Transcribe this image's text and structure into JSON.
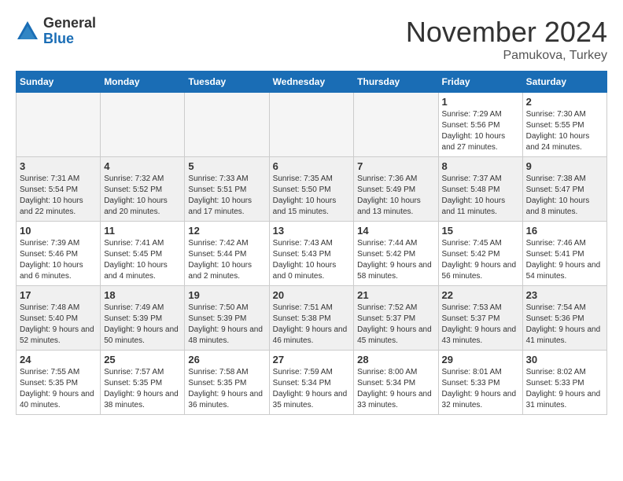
{
  "logo": {
    "general": "General",
    "blue": "Blue"
  },
  "header": {
    "month": "November 2024",
    "location": "Pamukova, Turkey"
  },
  "days_of_week": [
    "Sunday",
    "Monday",
    "Tuesday",
    "Wednesday",
    "Thursday",
    "Friday",
    "Saturday"
  ],
  "weeks": [
    [
      {
        "day": "",
        "info": ""
      },
      {
        "day": "",
        "info": ""
      },
      {
        "day": "",
        "info": ""
      },
      {
        "day": "",
        "info": ""
      },
      {
        "day": "",
        "info": ""
      },
      {
        "day": "1",
        "info": "Sunrise: 7:29 AM\nSunset: 5:56 PM\nDaylight: 10 hours and 27 minutes."
      },
      {
        "day": "2",
        "info": "Sunrise: 7:30 AM\nSunset: 5:55 PM\nDaylight: 10 hours and 24 minutes."
      }
    ],
    [
      {
        "day": "3",
        "info": "Sunrise: 7:31 AM\nSunset: 5:54 PM\nDaylight: 10 hours and 22 minutes."
      },
      {
        "day": "4",
        "info": "Sunrise: 7:32 AM\nSunset: 5:52 PM\nDaylight: 10 hours and 20 minutes."
      },
      {
        "day": "5",
        "info": "Sunrise: 7:33 AM\nSunset: 5:51 PM\nDaylight: 10 hours and 17 minutes."
      },
      {
        "day": "6",
        "info": "Sunrise: 7:35 AM\nSunset: 5:50 PM\nDaylight: 10 hours and 15 minutes."
      },
      {
        "day": "7",
        "info": "Sunrise: 7:36 AM\nSunset: 5:49 PM\nDaylight: 10 hours and 13 minutes."
      },
      {
        "day": "8",
        "info": "Sunrise: 7:37 AM\nSunset: 5:48 PM\nDaylight: 10 hours and 11 minutes."
      },
      {
        "day": "9",
        "info": "Sunrise: 7:38 AM\nSunset: 5:47 PM\nDaylight: 10 hours and 8 minutes."
      }
    ],
    [
      {
        "day": "10",
        "info": "Sunrise: 7:39 AM\nSunset: 5:46 PM\nDaylight: 10 hours and 6 minutes."
      },
      {
        "day": "11",
        "info": "Sunrise: 7:41 AM\nSunset: 5:45 PM\nDaylight: 10 hours and 4 minutes."
      },
      {
        "day": "12",
        "info": "Sunrise: 7:42 AM\nSunset: 5:44 PM\nDaylight: 10 hours and 2 minutes."
      },
      {
        "day": "13",
        "info": "Sunrise: 7:43 AM\nSunset: 5:43 PM\nDaylight: 10 hours and 0 minutes."
      },
      {
        "day": "14",
        "info": "Sunrise: 7:44 AM\nSunset: 5:42 PM\nDaylight: 9 hours and 58 minutes."
      },
      {
        "day": "15",
        "info": "Sunrise: 7:45 AM\nSunset: 5:42 PM\nDaylight: 9 hours and 56 minutes."
      },
      {
        "day": "16",
        "info": "Sunrise: 7:46 AM\nSunset: 5:41 PM\nDaylight: 9 hours and 54 minutes."
      }
    ],
    [
      {
        "day": "17",
        "info": "Sunrise: 7:48 AM\nSunset: 5:40 PM\nDaylight: 9 hours and 52 minutes."
      },
      {
        "day": "18",
        "info": "Sunrise: 7:49 AM\nSunset: 5:39 PM\nDaylight: 9 hours and 50 minutes."
      },
      {
        "day": "19",
        "info": "Sunrise: 7:50 AM\nSunset: 5:39 PM\nDaylight: 9 hours and 48 minutes."
      },
      {
        "day": "20",
        "info": "Sunrise: 7:51 AM\nSunset: 5:38 PM\nDaylight: 9 hours and 46 minutes."
      },
      {
        "day": "21",
        "info": "Sunrise: 7:52 AM\nSunset: 5:37 PM\nDaylight: 9 hours and 45 minutes."
      },
      {
        "day": "22",
        "info": "Sunrise: 7:53 AM\nSunset: 5:37 PM\nDaylight: 9 hours and 43 minutes."
      },
      {
        "day": "23",
        "info": "Sunrise: 7:54 AM\nSunset: 5:36 PM\nDaylight: 9 hours and 41 minutes."
      }
    ],
    [
      {
        "day": "24",
        "info": "Sunrise: 7:55 AM\nSunset: 5:35 PM\nDaylight: 9 hours and 40 minutes."
      },
      {
        "day": "25",
        "info": "Sunrise: 7:57 AM\nSunset: 5:35 PM\nDaylight: 9 hours and 38 minutes."
      },
      {
        "day": "26",
        "info": "Sunrise: 7:58 AM\nSunset: 5:35 PM\nDaylight: 9 hours and 36 minutes."
      },
      {
        "day": "27",
        "info": "Sunrise: 7:59 AM\nSunset: 5:34 PM\nDaylight: 9 hours and 35 minutes."
      },
      {
        "day": "28",
        "info": "Sunrise: 8:00 AM\nSunset: 5:34 PM\nDaylight: 9 hours and 33 minutes."
      },
      {
        "day": "29",
        "info": "Sunrise: 8:01 AM\nSunset: 5:33 PM\nDaylight: 9 hours and 32 minutes."
      },
      {
        "day": "30",
        "info": "Sunrise: 8:02 AM\nSunset: 5:33 PM\nDaylight: 9 hours and 31 minutes."
      }
    ]
  ]
}
